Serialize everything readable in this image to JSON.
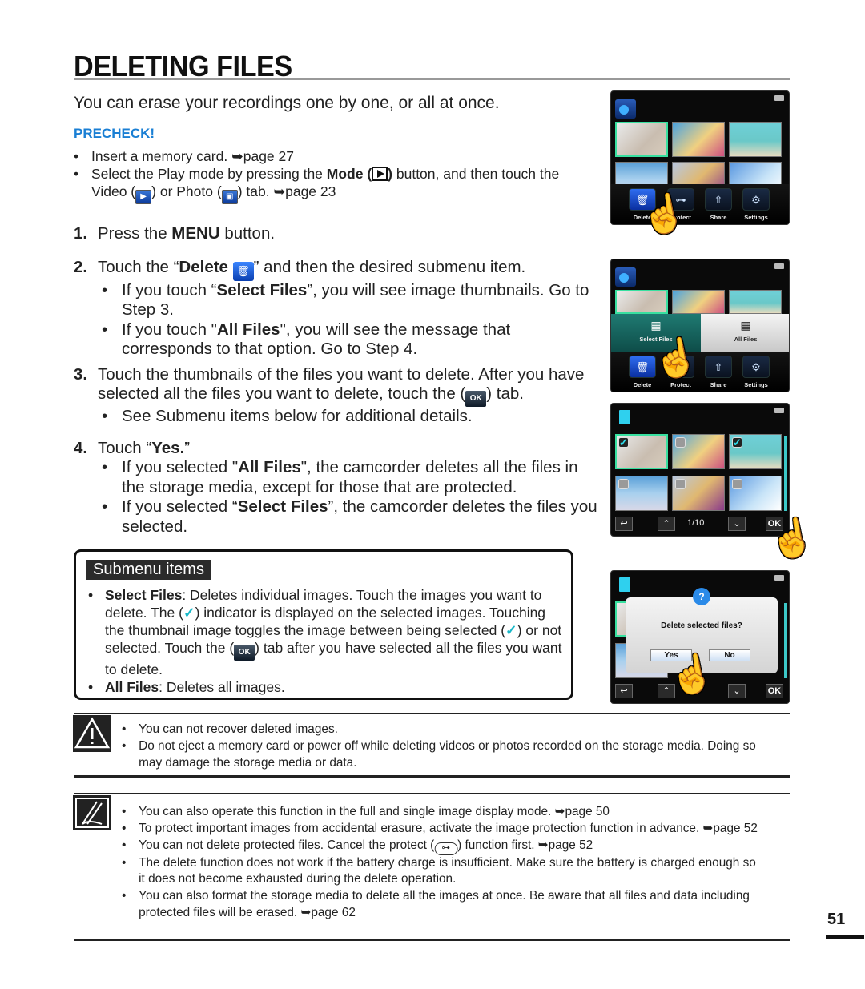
{
  "page": {
    "title": "DELETING FILES",
    "intro": "You can erase your recordings one by one, or all at once.",
    "page_number": "51"
  },
  "precheck": {
    "label": "PRECHECK!",
    "items": [
      {
        "text": "Insert a memory card. ",
        "ref": "➥page 27"
      },
      {
        "pre": "Select the Play mode by pressing the ",
        "bold": "Mode (",
        "bold_end": ")",
        "mid": " button, and then touch the Video (",
        "mid2": ") or Photo (",
        "post": ") tab. ",
        "ref": "➥page 23"
      }
    ]
  },
  "steps": [
    {
      "num": "1.",
      "pre": "Press the ",
      "bold": "MENU",
      "post": " button."
    },
    {
      "num": "2.",
      "pre": "Touch the “",
      "bold": "Delete ",
      "post": "” and then the desired submenu item.",
      "bullets": [
        {
          "pre": "If you touch “",
          "bold": "Select Files",
          "post": "”, you will see image thumbnails. Go to Step 3."
        },
        {
          "pre": "If you touch \"",
          "bold": "All Files",
          "post": "\", you will see the message that corresponds to that option. Go to Step 4."
        }
      ]
    },
    {
      "num": "3.",
      "pre": "Touch the thumbnails of the files you want to delete. After you have selected all the files you want to delete, touch the (",
      "post": ") tab.",
      "bullets": [
        {
          "text": "See Submenu items below for additional details."
        }
      ]
    },
    {
      "num": "4.",
      "pre": "Touch “",
      "bold": "Yes.",
      "post": "”",
      "bullets": [
        {
          "pre": "If you selected \"",
          "bold": "All Files",
          "post": "\", the camcorder deletes all the files in the storage media, except for those that are protected."
        },
        {
          "pre": "If you selected “",
          "bold": "Select Files",
          "post": "”, the camcorder deletes the files you selected."
        }
      ]
    }
  ],
  "submenu": {
    "label": "Submenu items",
    "items": [
      {
        "bold": "Select Files",
        "t1": ": Deletes individual images. Touch the images you want to delete. The (",
        "t2": ") indicator is displayed on the selected images. Touching the thumbnail image toggles the image between being selected (",
        "t3": ") or not selected. Touch the (",
        "t4": ") tab after you have selected all the files you want to delete."
      },
      {
        "bold": "All Files",
        "t1": ": Deletes all images."
      }
    ]
  },
  "caution": {
    "items": [
      "You can not recover deleted images.",
      "Do not eject a memory card or power off while deleting videos or photos recorded on the storage media. Doing so may damage the storage media or data."
    ]
  },
  "notes": {
    "items": [
      {
        "text": "You can also operate this function in the full and single image display mode. ",
        "ref": "➥page 50"
      },
      {
        "text": "To protect important images from accidental erasure, activate the image protection function in advance. ",
        "ref": "➥page 52"
      },
      {
        "pre": "You can not delete protected files. Cancel the protect (",
        "post": ") function first. ",
        "ref": "➥page 52"
      },
      {
        "text": "The delete function does not work if the battery charge is insufficient. Make sure the battery is charged enough so it does not become exhausted during the delete operation."
      },
      {
        "text": "You can also format the storage media to delete all the images at once. Be aware that all files and data including protected files will be erased. ",
        "ref": "➥page 62"
      }
    ]
  },
  "screens": {
    "menu": {
      "delete": "Delete",
      "protect": "Protect",
      "share": "Share",
      "settings": "Settings"
    },
    "submenu": {
      "select_files": "Select Files",
      "all_files": "All Files"
    },
    "selection": {
      "page_indicator": "1/10",
      "ok": "OK"
    },
    "dialog": {
      "message": "Delete selected files?",
      "yes": "Yes",
      "no": "No",
      "ok": "OK"
    }
  },
  "icons": {
    "check": "✓",
    "ok": "OK",
    "trash": "🗑",
    "key": "╀"
  }
}
